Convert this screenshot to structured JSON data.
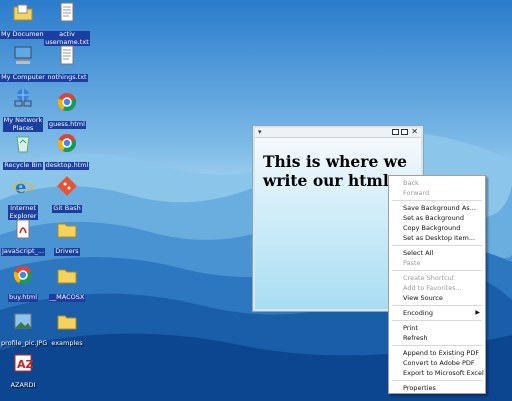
{
  "desktop": {
    "icons": [
      {
        "label": "My Documents",
        "icon": "folder-documents-icon",
        "selected": true
      },
      {
        "label": "activ\nusername.txt",
        "icon": "text-file-icon",
        "selected": true
      },
      {
        "label": "My Computer",
        "icon": "computer-icon",
        "selected": true
      },
      {
        "label": "nothings.txt",
        "icon": "text-file-icon",
        "selected": true
      },
      {
        "label": "My Network\nPlaces",
        "icon": "network-places-icon",
        "selected": true
      },
      {
        "label": "guess.html",
        "icon": "chrome-icon",
        "selected": true
      },
      {
        "label": "Recycle Bin",
        "icon": "recycle-bin-icon",
        "selected": true
      },
      {
        "label": "desktop.html",
        "icon": "chrome-icon",
        "selected": true
      },
      {
        "label": "Internet\nExplorer",
        "icon": "internet-explorer-icon",
        "selected": true
      },
      {
        "label": "Git Bash",
        "icon": "git-bash-icon",
        "selected": true
      },
      {
        "label": "JavaScript_...",
        "icon": "pdf-icon",
        "selected": true
      },
      {
        "label": "Drivers",
        "icon": "folder-icon",
        "selected": true
      },
      {
        "label": "buy.html",
        "icon": "chrome-icon",
        "selected": true
      },
      {
        "label": "__MACOSX",
        "icon": "folder-icon",
        "selected": true
      },
      {
        "label": "profile_pic.JPG",
        "icon": "image-file-icon",
        "selected": false
      },
      {
        "label": "examples",
        "icon": "folder-icon",
        "selected": false
      },
      {
        "label": "AZARDI",
        "icon": "azardi-icon",
        "selected": false
      }
    ]
  },
  "window": {
    "sysmenu": "▾",
    "heading": "This is where we write our html"
  },
  "context_menu": {
    "items": [
      {
        "label": "Back",
        "disabled": true
      },
      {
        "label": "Forward",
        "disabled": true
      },
      {
        "sep": true
      },
      {
        "label": "Save Background As...",
        "disabled": false
      },
      {
        "label": "Set as Background",
        "disabled": false
      },
      {
        "label": "Copy Background",
        "disabled": false
      },
      {
        "label": "Set as Desktop Item...",
        "disabled": false
      },
      {
        "sep": true
      },
      {
        "label": "Select All",
        "disabled": false
      },
      {
        "label": "Paste",
        "disabled": true
      },
      {
        "sep": true
      },
      {
        "label": "Create Shortcut",
        "disabled": true
      },
      {
        "label": "Add to Favorites...",
        "disabled": true
      },
      {
        "label": "View Source",
        "disabled": false
      },
      {
        "sep": true
      },
      {
        "label": "Encoding",
        "disabled": false,
        "submenu": true
      },
      {
        "sep": true
      },
      {
        "label": "Print",
        "disabled": false
      },
      {
        "label": "Refresh",
        "disabled": false
      },
      {
        "sep": true
      },
      {
        "label": "Append to Existing PDF",
        "disabled": false
      },
      {
        "label": "Convert to Adobe PDF",
        "disabled": false
      },
      {
        "label": "Export to Microsoft Excel",
        "disabled": false
      },
      {
        "sep": true
      },
      {
        "label": "Properties",
        "disabled": false
      }
    ]
  },
  "colors": {
    "selection": "#1b3fa0",
    "sky_top": "#2e7fd0",
    "sky_bottom": "#9fd0ee",
    "mountain_far": "#5ea6dc",
    "mountain_near": "#0a3f8a"
  }
}
